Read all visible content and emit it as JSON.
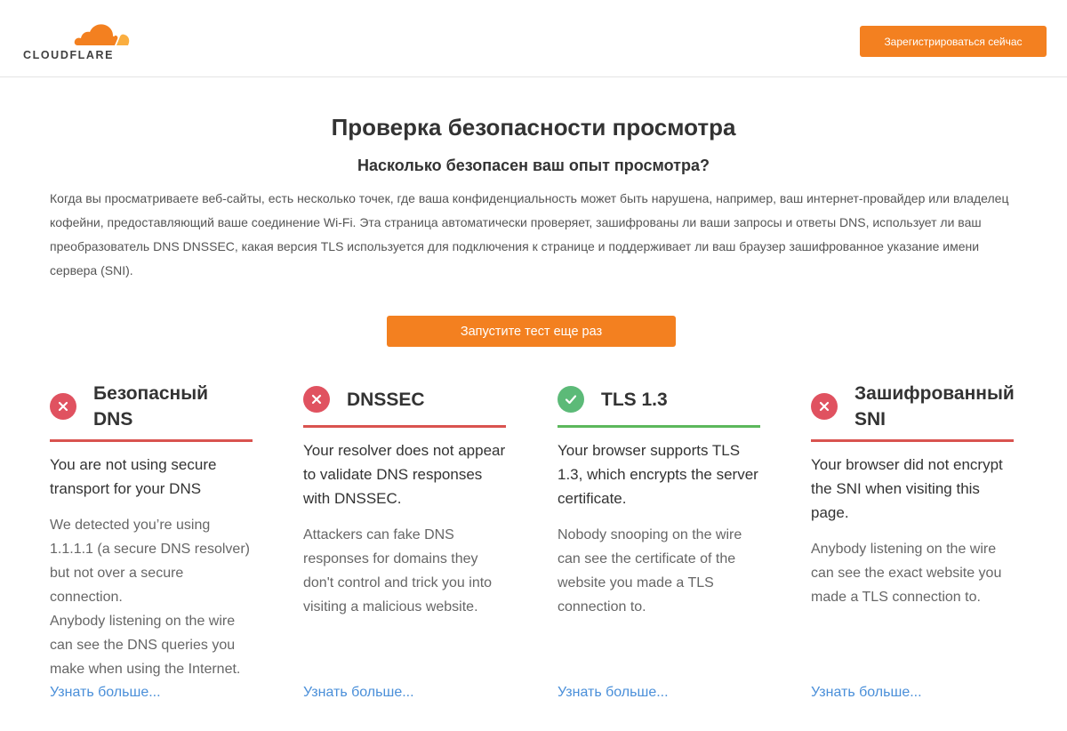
{
  "header": {
    "brand": "CLOUDFLARE",
    "register_button": "Зарегистрироваться сейчас"
  },
  "main": {
    "title": "Проверка безопасности просмотра",
    "subtitle": "Насколько безопасен ваш опыт просмотра?",
    "description": "Когда вы просматриваете веб-сайты, есть несколько точек, где ваша конфиденциальность может быть нарушена, например, ваш интернет-провайдер или владелец кофейни, предоставляющий ваше соединение Wi-Fi. Эта страница автоматически проверяет, зашифрованы ли ваши запросы и ответы DNS, использует ли ваш преобразователь DNS DNSSEC, какая версия TLS используется для подключения к странице и поддерживает ли ваш браузер зашифрованное указание имени сервера (SNI).",
    "run_button": "Запустите тест еще раз"
  },
  "colors": {
    "accent": "#f38020",
    "fail": "#e05260",
    "pass": "#5cba78",
    "link": "#4a8fd9"
  },
  "cards": [
    {
      "title": "Безопасный DNS",
      "status": "fail",
      "icon": "x-circle-icon",
      "lead": "You are not using secure transport for your DNS",
      "body": "We detected you’re using 1.1.1.1 (a secure DNS resolver) but not over a secure connection.\nAnybody listening on the wire can see the DNS queries you make when using the Internet.",
      "link": "Узнать больше..."
    },
    {
      "title": "DNSSEC",
      "status": "fail",
      "icon": "x-circle-icon",
      "lead": "Your resolver does not appear to validate DNS responses with DNSSEC.",
      "body": "Attackers can fake DNS responses for domains they don't control and trick you into visiting a malicious website.",
      "link": "Узнать больше..."
    },
    {
      "title": "TLS 1.3",
      "status": "pass",
      "icon": "check-circle-icon",
      "lead": "Your browser supports TLS 1.3, which encrypts the server certificate.",
      "body": "Nobody snooping on the wire can see the certificate of the website you made a TLS connection to.",
      "link": "Узнать больше..."
    },
    {
      "title": "Зашифрованный SNI",
      "status": "fail",
      "icon": "x-circle-icon",
      "lead": "Your browser did not encrypt the SNI when visiting this page.",
      "body": "Anybody listening on the wire can see the exact website you made a TLS connection to.",
      "link": "Узнать больше..."
    }
  ]
}
